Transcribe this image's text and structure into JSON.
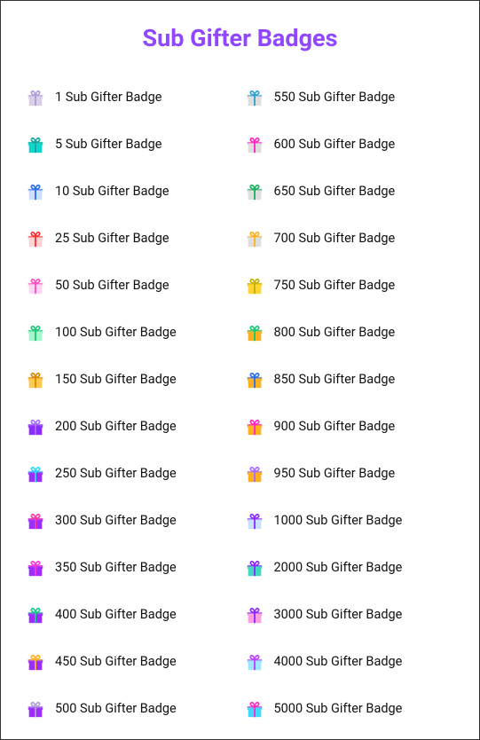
{
  "title": "Sub Gifter Badges",
  "badges": [
    {
      "count": "1",
      "label": "1 Sub Gifter Badge",
      "ribbon": "#b19cd9",
      "box": "#d9d0e8"
    },
    {
      "count": "5",
      "label": "5 Sub Gifter Badge",
      "ribbon": "#16a6a0",
      "box": "#0fd6cc"
    },
    {
      "count": "10",
      "label": "10 Sub Gifter Badge",
      "ribbon": "#2a6ff0",
      "box": "#cfe0ff"
    },
    {
      "count": "25",
      "label": "25 Sub Gifter Badge",
      "ribbon": "#ff2d2d",
      "box": "#ffd3d3"
    },
    {
      "count": "50",
      "label": "50 Sub Gifter Badge",
      "ribbon": "#ff4fc4",
      "box": "#ffd6f2"
    },
    {
      "count": "100",
      "label": "100 Sub Gifter Badge",
      "ribbon": "#18c874",
      "box": "#a3f7cc"
    },
    {
      "count": "150",
      "label": "150 Sub Gifter Badge",
      "ribbon": "#d68a00",
      "box": "#ffc94d"
    },
    {
      "count": "200",
      "label": "200 Sub Gifter Badge",
      "ribbon": "#a56eff",
      "box": "#8a2bff"
    },
    {
      "count": "250",
      "label": "250 Sub Gifter Badge",
      "ribbon": "#2fd9ff",
      "box": "#9b2dff"
    },
    {
      "count": "300",
      "label": "300 Sub Gifter Badge",
      "ribbon": "#ff38a6",
      "box": "#9b2dff"
    },
    {
      "count": "350",
      "label": "350 Sub Gifter Badge",
      "ribbon": "#ff38d8",
      "box": "#9b2dff"
    },
    {
      "count": "400",
      "label": "400 Sub Gifter Badge",
      "ribbon": "#19c98c",
      "box": "#9b2dff"
    },
    {
      "count": "450",
      "label": "450 Sub Gifter Badge",
      "ribbon": "#ffb020",
      "box": "#9b2dff"
    },
    {
      "count": "500",
      "label": "500 Sub Gifter Badge",
      "ribbon": "#b19cd9",
      "box": "#9b2dff"
    },
    {
      "count": "550",
      "label": "550 Sub Gifter Badge",
      "ribbon": "#2fa0d0",
      "box": "#dedede"
    },
    {
      "count": "600",
      "label": "600 Sub Gifter Badge",
      "ribbon": "#ff26c2",
      "box": "#dedede"
    },
    {
      "count": "650",
      "label": "650 Sub Gifter Badge",
      "ribbon": "#18b060",
      "box": "#dedede"
    },
    {
      "count": "700",
      "label": "700 Sub Gifter Badge",
      "ribbon": "#ffb020",
      "box": "#dedede"
    },
    {
      "count": "750",
      "label": "750 Sub Gifter Badge",
      "ribbon": "#c4b000",
      "box": "#ffd633"
    },
    {
      "count": "800",
      "label": "800 Sub Gifter Badge",
      "ribbon": "#18c874",
      "box": "#ffb020"
    },
    {
      "count": "850",
      "label": "850 Sub Gifter Badge",
      "ribbon": "#2a6ff0",
      "box": "#ffb020"
    },
    {
      "count": "900",
      "label": "900 Sub Gifter Badge",
      "ribbon": "#ff26c2",
      "box": "#ffb020"
    },
    {
      "count": "950",
      "label": "950 Sub Gifter Badge",
      "ribbon": "#a56eff",
      "box": "#ffb020"
    },
    {
      "count": "1000",
      "label": "1000 Sub Gifter Badge",
      "ribbon": "#8a2bff",
      "box": "#c9dfff"
    },
    {
      "count": "2000",
      "label": "2000 Sub Gifter Badge",
      "ribbon": "#8a2bff",
      "box": "#40d9c0"
    },
    {
      "count": "3000",
      "label": "3000 Sub Gifter Badge",
      "ribbon": "#8a2bff",
      "box": "#ff9edf"
    },
    {
      "count": "4000",
      "label": "4000 Sub Gifter Badge",
      "ribbon": "#c040ff",
      "box": "#9be8ff"
    },
    {
      "count": "5000",
      "label": "5000 Sub Gifter Badge",
      "ribbon": "#ff2dc0",
      "box": "#40d9ff"
    }
  ]
}
